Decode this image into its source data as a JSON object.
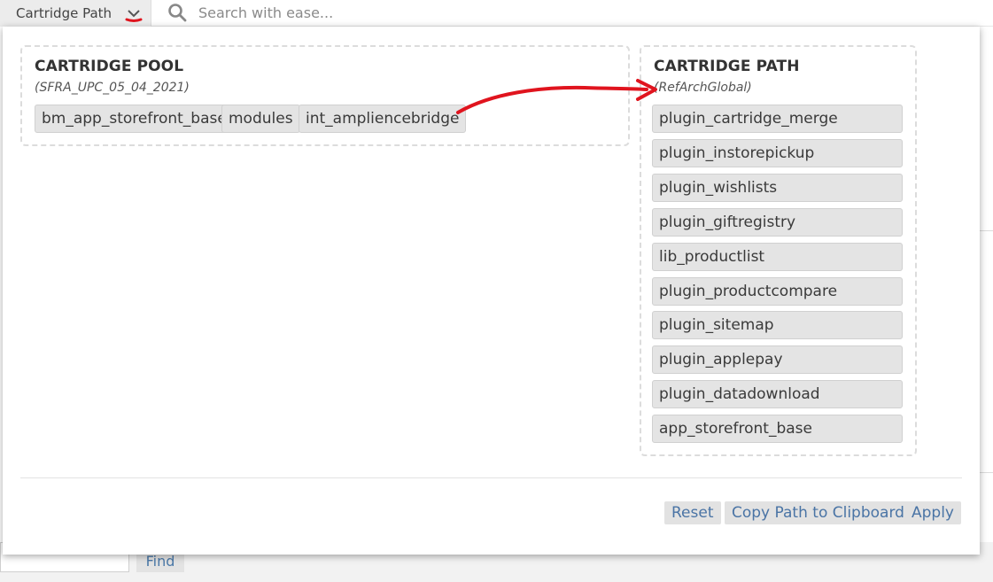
{
  "toolbar": {
    "path_toggle_label": "Cartridge Path",
    "search_placeholder": "Search with ease..."
  },
  "pool": {
    "title": "CARTRIDGE POOL",
    "subtitle": "(SFRA_UPC_05_04_2021)",
    "cartridges": [
      "bm_app_storefront_base",
      "modules",
      "int_ampliencebridge"
    ]
  },
  "path": {
    "title": "CARTRIDGE PATH",
    "subtitle": "(RefArchGlobal)",
    "cartridges": [
      "plugin_cartridge_merge",
      "plugin_instorepickup",
      "plugin_wishlists",
      "plugin_giftregistry",
      "lib_productlist",
      "plugin_productcompare",
      "plugin_sitemap",
      "plugin_applepay",
      "plugin_datadownload",
      "app_storefront_base"
    ]
  },
  "actions": {
    "reset": "Reset",
    "copy": "Copy Path to Clipboard",
    "apply": "Apply"
  },
  "background": {
    "find_label": "Find"
  },
  "colors": {
    "accent_link": "#4a74a5",
    "chip_bg": "#e4e4e4",
    "annotation": "#e0141e"
  }
}
